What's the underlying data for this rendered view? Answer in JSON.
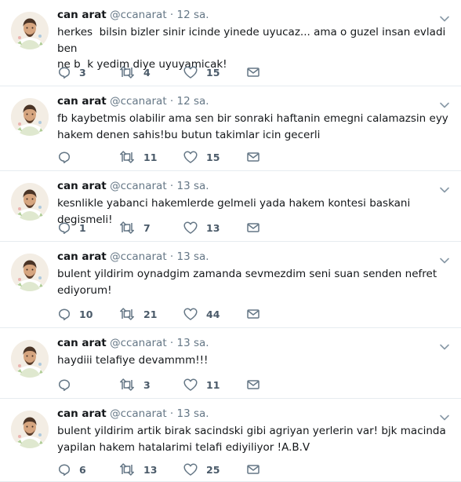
{
  "tweets": [
    {
      "name": "can arat",
      "handle": "@ccanarat",
      "dot": "·",
      "time": "12 sa.",
      "text": "herkes  bilsin bizler sinir icinde yinede uyucaz... ama o guzel insan evladi ben\nne b  k yedim diye uyuyamicak!",
      "replies": "3",
      "retweets": "4",
      "likes": "15"
    },
    {
      "name": "can arat",
      "handle": "@ccanarat",
      "dot": "·",
      "time": "12 sa.",
      "text": "fb kaybetmis olabilir ama sen bir sonraki haftanin emegni calamazsin eyy\nhakem denen sahis!bu butun takimlar icin gecerli",
      "replies": "",
      "retweets": "11",
      "likes": "15"
    },
    {
      "name": "can arat",
      "handle": "@ccanarat",
      "dot": "·",
      "time": "13 sa.",
      "text": "kesnlikle yabanci hakemlerde gelmeli yada hakem kontesi baskani degismeli!",
      "replies": "1",
      "retweets": "7",
      "likes": "13"
    },
    {
      "name": "can arat",
      "handle": "@ccanarat",
      "dot": "·",
      "time": "13 sa.",
      "text": "bulent yildirim oynadgim zamanda sevmezdim seni suan senden nefret\nediyorum!",
      "replies": "10",
      "retweets": "21",
      "likes": "44"
    },
    {
      "name": "can arat",
      "handle": "@ccanarat",
      "dot": "·",
      "time": "13 sa.",
      "text": "haydiii telafiye devammm!!!",
      "replies": "",
      "retweets": "3",
      "likes": "11"
    },
    {
      "name": "can arat",
      "handle": "@ccanarat",
      "dot": "·",
      "time": "13 sa.",
      "text": "bulent yildirim artik birak sacindski gibi agriyan yerlerin var! bjk macinda\nyapilan hakem hatalarimi telafi ediyiliyor !A.B.V",
      "replies": "6",
      "retweets": "13",
      "likes": "25"
    }
  ],
  "icons": {
    "reply": "reply-icon",
    "retweet": "retweet-icon",
    "like": "heart-icon",
    "dm": "envelope-icon",
    "caret": "chevron-down-icon",
    "avatar": "avatar"
  },
  "colors": {
    "text": "#14171a",
    "muted": "#657786",
    "divider": "#e6ecf0"
  }
}
